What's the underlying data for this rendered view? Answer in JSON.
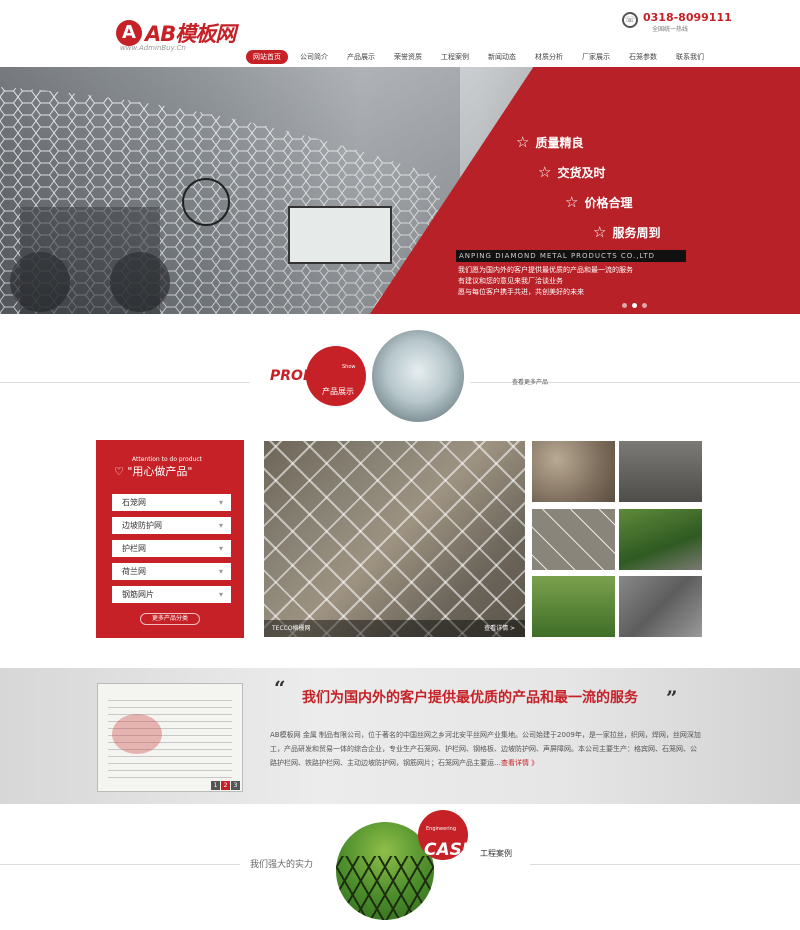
{
  "header": {
    "logo_mark": "A",
    "logo_text": "AB模板网",
    "logo_url": "www.AdminBuy.Cn",
    "phone": "0318-8099111",
    "phone_sub": "全国统一热线"
  },
  "nav": [
    "网站首页",
    "公司简介",
    "产品展示",
    "荣誉资质",
    "工程案例",
    "新闻动态",
    "材质分析",
    "厂家展示",
    "石笼参数",
    "联系我们"
  ],
  "banner": {
    "slogans": [
      "质量精良",
      "交货及时",
      "价格合理",
      "服务周到"
    ],
    "company_en": "ANPING DIAMOND METAL PRODUCTS CO.,LTD",
    "text_lines": [
      "我们愿为国内外的客户提供最优质的产品和最一流的服务",
      "有建议和您的意见来我厂洽谈业务",
      "愿与每位客户携手共进，共创美好的未来"
    ],
    "star": "☆"
  },
  "products_head": {
    "en": "PRODUCTS",
    "small": "Show",
    "cn": "产品展示",
    "more": "查看更多产品"
  },
  "sidebar": {
    "en": "Attention to do product",
    "title": "\"用心做产品\"",
    "heart": "♡",
    "items": [
      "石笼网",
      "边坡防护网",
      "护栏网",
      "荷兰网",
      "钢筋网片"
    ],
    "more": "更多产品分类",
    "arrow": "▾"
  },
  "featured": {
    "caption": "TECCO格栅网",
    "detail": "查看详情 >"
  },
  "about": {
    "title": "我们为国内外的客户提供最优质的产品和最一流的服务",
    "open_quote": "“",
    "close_quote": "”",
    "body": "AB模板网 金属 制品有限公司，位于著名的中国丝网之乡河北安平丝网产业集地。公司始建于2009年，是一家拉丝，织网，焊网，丝网深加工，产品研发和贸易一体的综合企业，专业生产石笼网、护栏网、钢格板、边坡防护网、声屏障网。本公司主要生产：格宾网、石笼网、公路护栏网、铁路护栏网、主动边坡防护网，钢筋网片；石笼网产品主要运…",
    "more": "查看详情 》",
    "pages": [
      "1",
      "2",
      "3"
    ]
  },
  "case": {
    "small": "Engineering",
    "en": "CASE",
    "cn": "工程案例",
    "left": "我们强大的实力"
  },
  "colors": {
    "accent": "#c52127",
    "dark": "#333333"
  }
}
